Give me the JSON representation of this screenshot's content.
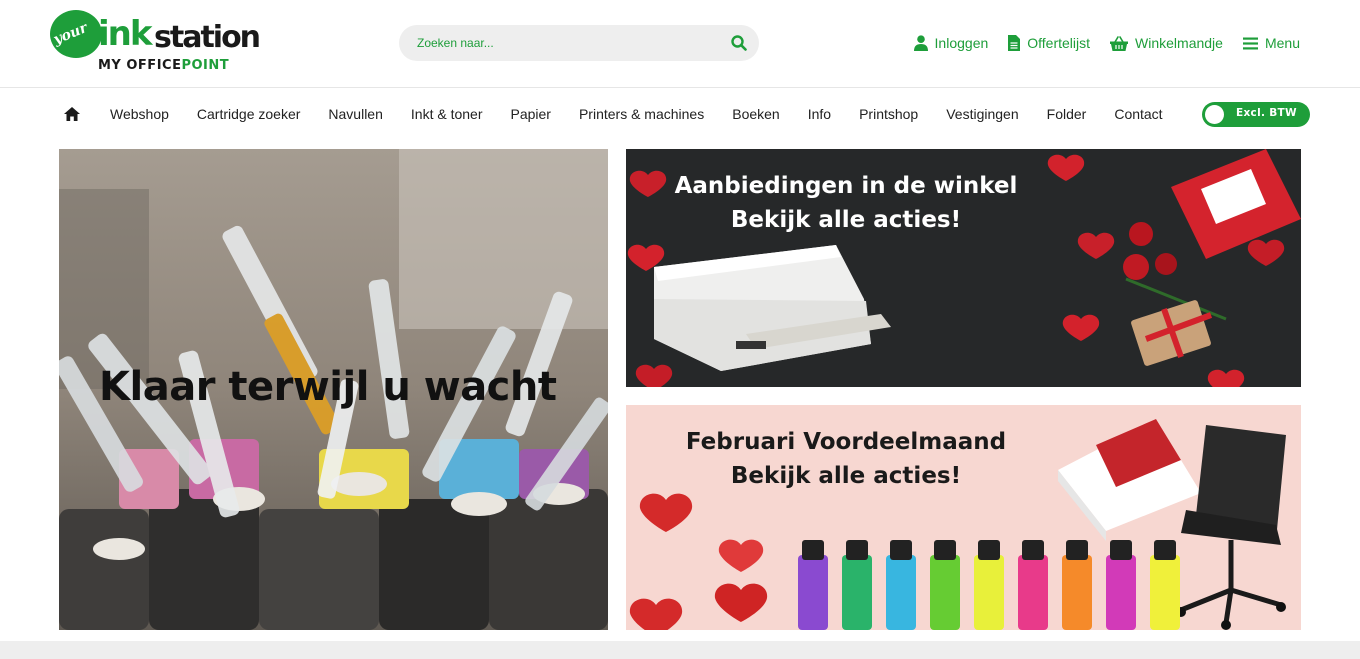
{
  "brand": {
    "logo_your": "your",
    "logo_ink": "ink",
    "logo_station": "station",
    "logo_sub_my_office": "MY OFFICE",
    "logo_sub_point": "POINT",
    "green": "#1e9e3a"
  },
  "search": {
    "placeholder": "Zoeken naar..."
  },
  "actions": [
    {
      "label": "Inloggen",
      "icon": "user-icon"
    },
    {
      "label": "Offertelijst",
      "icon": "document-icon"
    },
    {
      "label": "Winkelmandje",
      "icon": "basket-icon"
    },
    {
      "label": "Menu",
      "icon": "hamburger-icon"
    }
  ],
  "nav": {
    "home_icon": "home-icon",
    "items": [
      "Webshop",
      "Cartridge zoeker",
      "Navullen",
      "Inkt & toner",
      "Papier",
      "Printers & machines",
      "Boeken",
      "Info",
      "Printshop",
      "Vestigingen",
      "Folder",
      "Contact"
    ],
    "vat_toggle_label": "Excl. BTW"
  },
  "banners": {
    "refill": {
      "headline": "Klaar terwijl u wacht"
    },
    "store_offers": {
      "line1": "Aanbiedingen in de winkel",
      "line2": "Bekijk alle acties!"
    },
    "february": {
      "line1": "Februari Voordeelmaand",
      "line2": "Bekijk alle acties!"
    }
  }
}
